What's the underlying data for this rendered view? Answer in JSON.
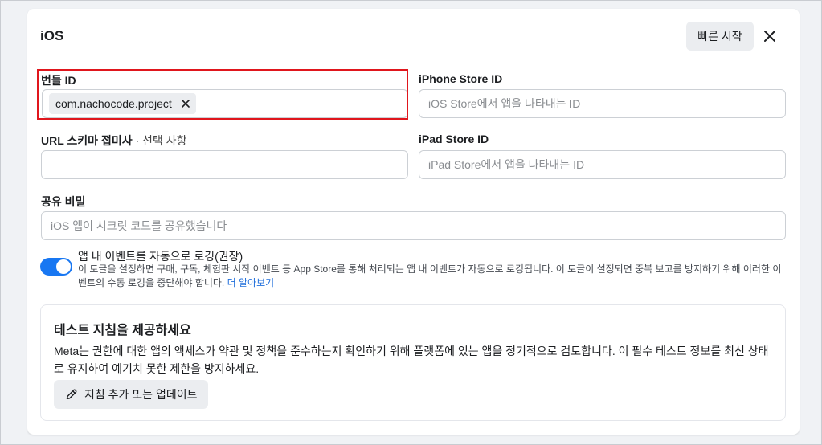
{
  "dialog": {
    "title": "iOS",
    "quick_start_label": "빠른 시작",
    "close_icon": "close-icon"
  },
  "bundle_id": {
    "label": "번들 ID",
    "tokens": [
      "com.nachocode.project"
    ],
    "remove_icon": "close-icon"
  },
  "iphone_store_id": {
    "label": "iPhone Store ID",
    "value": "",
    "placeholder": "iOS Store에서 앱을 나타내는 ID"
  },
  "url_scheme": {
    "label": "URL 스키마 접미사",
    "optional_suffix": " · 선택 사항",
    "value": "",
    "placeholder": ""
  },
  "ipad_store_id": {
    "label": "iPad Store ID",
    "value": "",
    "placeholder": "iPad Store에서 앱을 나타내는 ID"
  },
  "shared_secret": {
    "label": "공유 비밀",
    "value": "",
    "placeholder": "iOS 앱이 시크릿 코드를 공유했습니다"
  },
  "auto_log": {
    "title": "앱 내 이벤트를 자동으로 로깅(권장)",
    "enabled": true,
    "toggle_color": "#1877f2",
    "description": "이 토글을 설정하면 구매, 구독, 체험판 시작 이벤트 등 App Store를 통해 처리되는 앱 내 이벤트가 자동으로 로깅됩니다. 이 토글이 설정되면 중복 보고를 방지하기 위해 이러한 이벤트의 수동 로깅을 중단해야 합니다. ",
    "learn_more": "더 알아보기"
  },
  "test_card": {
    "title": "테스트 지침을 제공하세요",
    "body": "Meta는 권한에 대한 앱의 액세스가 약관 및 정책을 준수하는지 확인하기 위해 플랫폼에 있는 앱을 정기적으로 검토합니다. 이 필수 테스트 정보를 최신 상태로 유지하여 예기치 못한 제한을 방지하세요.",
    "button_label": "지침 추가 또는 업데이트",
    "button_icon": "pencil-icon"
  },
  "colors": {
    "highlight": "#e0161d",
    "link": "#216fdb"
  }
}
